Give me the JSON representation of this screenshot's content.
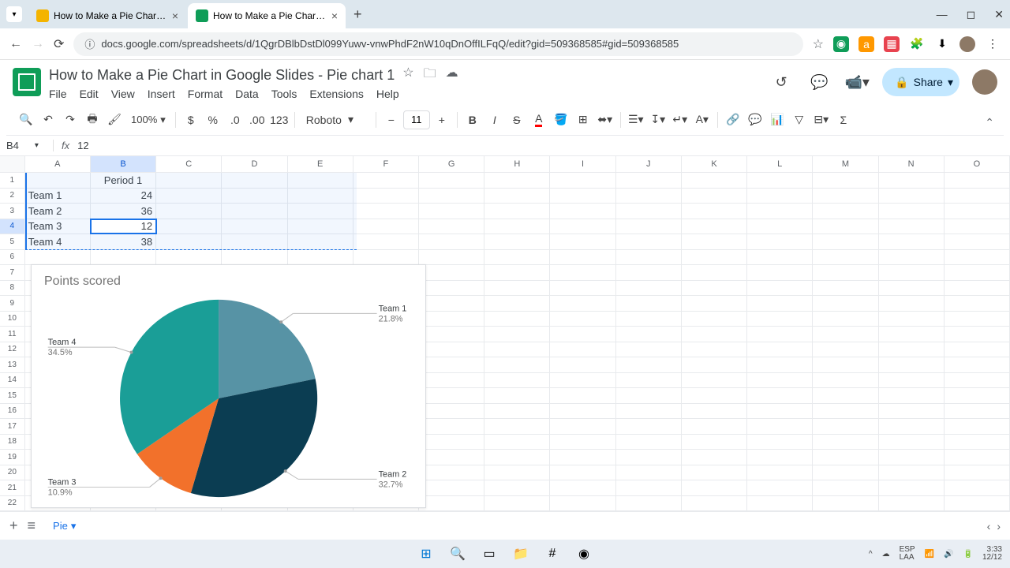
{
  "browser": {
    "tab1": {
      "title": "How to Make a Pie Chart in Go..."
    },
    "tab2": {
      "title": "How to Make a Pie Chart in Go..."
    },
    "url": "docs.google.com/spreadsheets/d/1QgrDBlbDstDl099Yuwv-vnwPhdF2nW10qDnOffILFqQ/edit?gid=509368585#gid=509368585"
  },
  "doc": {
    "title": "How to Make a Pie Chart in Google Slides - Pie chart 1",
    "menus": {
      "file": "File",
      "edit": "Edit",
      "view": "View",
      "insert": "Insert",
      "format": "Format",
      "data": "Data",
      "tools": "Tools",
      "extensions": "Extensions",
      "help": "Help"
    },
    "share": "Share"
  },
  "toolbar": {
    "zoom": "100%",
    "font": "Roboto",
    "size": "11",
    "num_fmt": "123"
  },
  "namebox": {
    "ref": "B4",
    "fx": "fx",
    "val": "12"
  },
  "cols": [
    "A",
    "B",
    "C",
    "D",
    "E",
    "F",
    "G",
    "H",
    "I",
    "J",
    "K",
    "L",
    "M",
    "N",
    "O"
  ],
  "rows_count": 24,
  "cells": {
    "B1": "Period 1",
    "A2": "Team 1",
    "B2": "24",
    "A3": "Team 2",
    "B3": "36",
    "A4": "Team 3",
    "B4": "12",
    "A5": "Team 4",
    "B5": "38"
  },
  "chart_data": {
    "type": "pie",
    "title": "Points scored",
    "series": [
      {
        "name": "Team 1",
        "value": 24,
        "pct": "21.8%",
        "color": "#5793a5"
      },
      {
        "name": "Team 2",
        "value": 36,
        "pct": "32.7%",
        "color": "#0b3d52"
      },
      {
        "name": "Team 3",
        "value": 12,
        "pct": "10.9%",
        "color": "#f2712b"
      },
      {
        "name": "Team 4",
        "value": 38,
        "pct": "34.5%",
        "color": "#1a9e97"
      }
    ]
  },
  "sheet_tabs": {
    "active": "Pie"
  },
  "taskbar": {
    "lang": "ESP\nLAA",
    "time": "3:33",
    "date": "12/12"
  }
}
